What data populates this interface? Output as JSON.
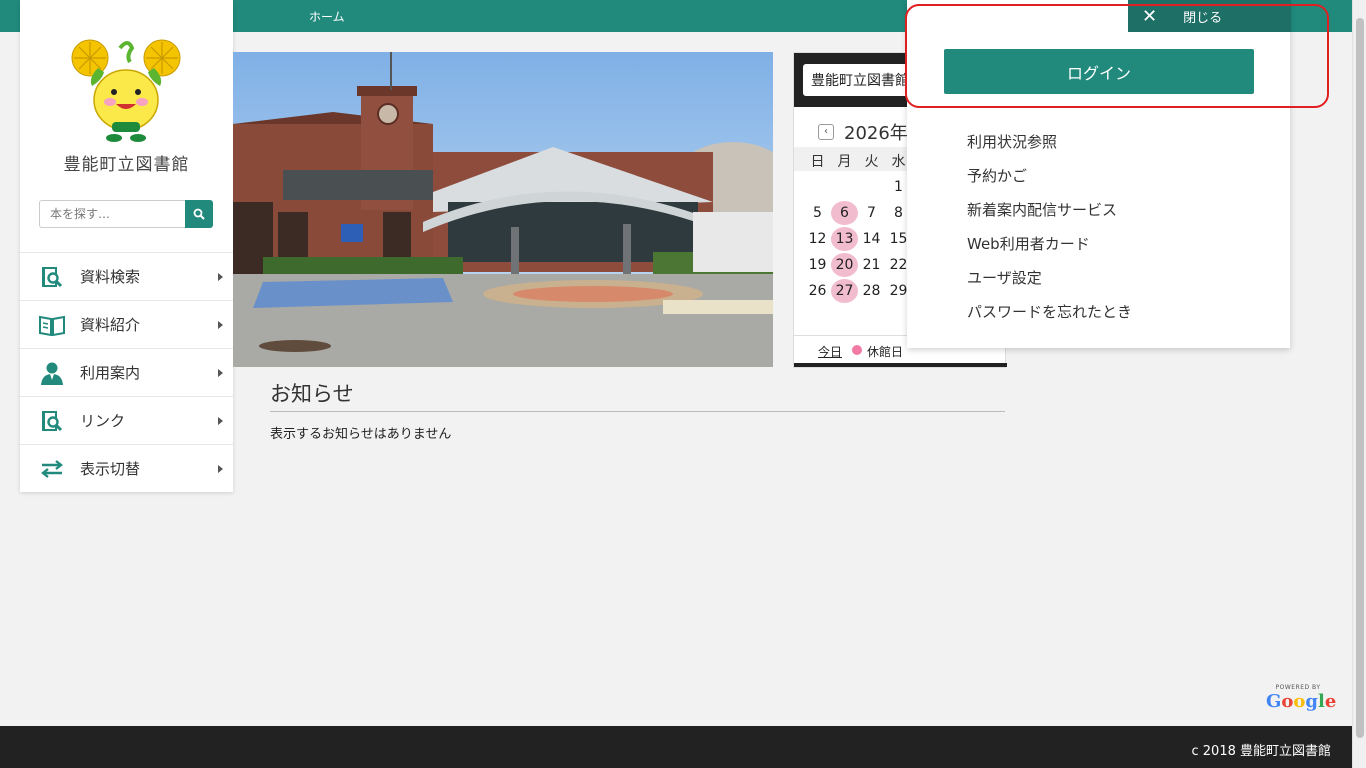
{
  "topbar": {
    "home_label": "ホーム"
  },
  "sidebar": {
    "library_name": "豊能町立図書館",
    "search_placeholder": "本を探す…",
    "menu": [
      {
        "label": "資料検索",
        "icon": "book-search-icon"
      },
      {
        "label": "資料紹介",
        "icon": "open-book-icon"
      },
      {
        "label": "利用案内",
        "icon": "user-icon"
      },
      {
        "label": "リンク",
        "icon": "book-search-icon"
      },
      {
        "label": "表示切替",
        "icon": "swap-arrows-icon"
      }
    ]
  },
  "calendar": {
    "library_select": "豊能町立図書館",
    "month": "2026年",
    "weekdays": [
      "日",
      "月",
      "火",
      "水"
    ],
    "rows": [
      [
        "",
        "",
        "",
        "1"
      ],
      [
        "5",
        "6",
        "7",
        "8"
      ],
      [
        "12",
        "13",
        "14",
        "15"
      ],
      [
        "19",
        "20",
        "21",
        "22"
      ],
      [
        "26",
        "27",
        "28",
        "29"
      ]
    ],
    "closed_days": [
      "6",
      "13",
      "20",
      "27"
    ],
    "today_label": "今日",
    "legend_closed": "休館日",
    "closed_color": "#f2bccf"
  },
  "notices": {
    "title": "お知らせ",
    "empty_text": "表示するお知らせはありません"
  },
  "dropdown": {
    "close_label": "閉じる",
    "login_label": "ログイン",
    "items": [
      "利用状況参照",
      "予約かご",
      "新着案内配信サービス",
      "Web利用者カード",
      "ユーザ設定",
      "パスワードを忘れたとき"
    ]
  },
  "badge": {
    "powered": "POWERED BY",
    "google": "Google"
  },
  "footer": {
    "copyright": "c 2018 豊能町立図書館"
  },
  "colors": {
    "accent": "#218a7d",
    "highlight": "#e02020"
  }
}
